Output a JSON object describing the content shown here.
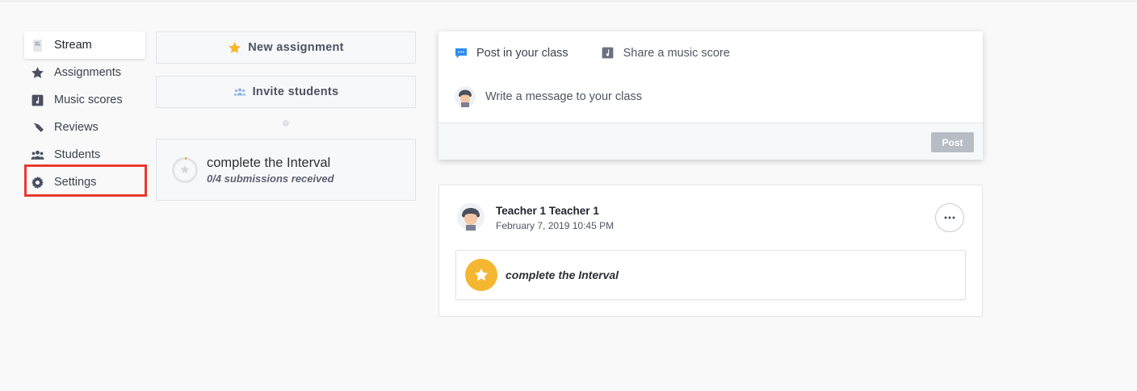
{
  "colors": {
    "accent_star": "#f5b731",
    "highlight": "#e8392f",
    "post_button_disabled": "#b8bcc5",
    "chat_icon": "#2d8cf0"
  },
  "sidebar": {
    "items": [
      {
        "label": "Stream",
        "icon": "document-icon",
        "active": true
      },
      {
        "label": "Assignments",
        "icon": "star-icon",
        "active": false
      },
      {
        "label": "Music scores",
        "icon": "music-score-icon",
        "active": false
      },
      {
        "label": "Reviews",
        "icon": "pen-nib-icon",
        "active": false
      },
      {
        "label": "Students",
        "icon": "people-icon",
        "active": false
      },
      {
        "label": "Settings",
        "icon": "gear-icon",
        "active": false,
        "highlighted": true
      }
    ]
  },
  "actions": {
    "new_assignment": "New assignment",
    "invite_students": "Invite students"
  },
  "assignment_card": {
    "title": "complete the Interval",
    "subtitle": "0/4 submissions received",
    "submitted": 0,
    "total": 4
  },
  "composer": {
    "tab_post": "Post in your class",
    "tab_share": "Share a music score",
    "placeholder": "Write a message to your class",
    "post_button": "Post"
  },
  "post": {
    "author": "Teacher 1 Teacher 1",
    "date": "February 7, 2019 10:45 PM",
    "attachment_title": "complete the Interval"
  }
}
